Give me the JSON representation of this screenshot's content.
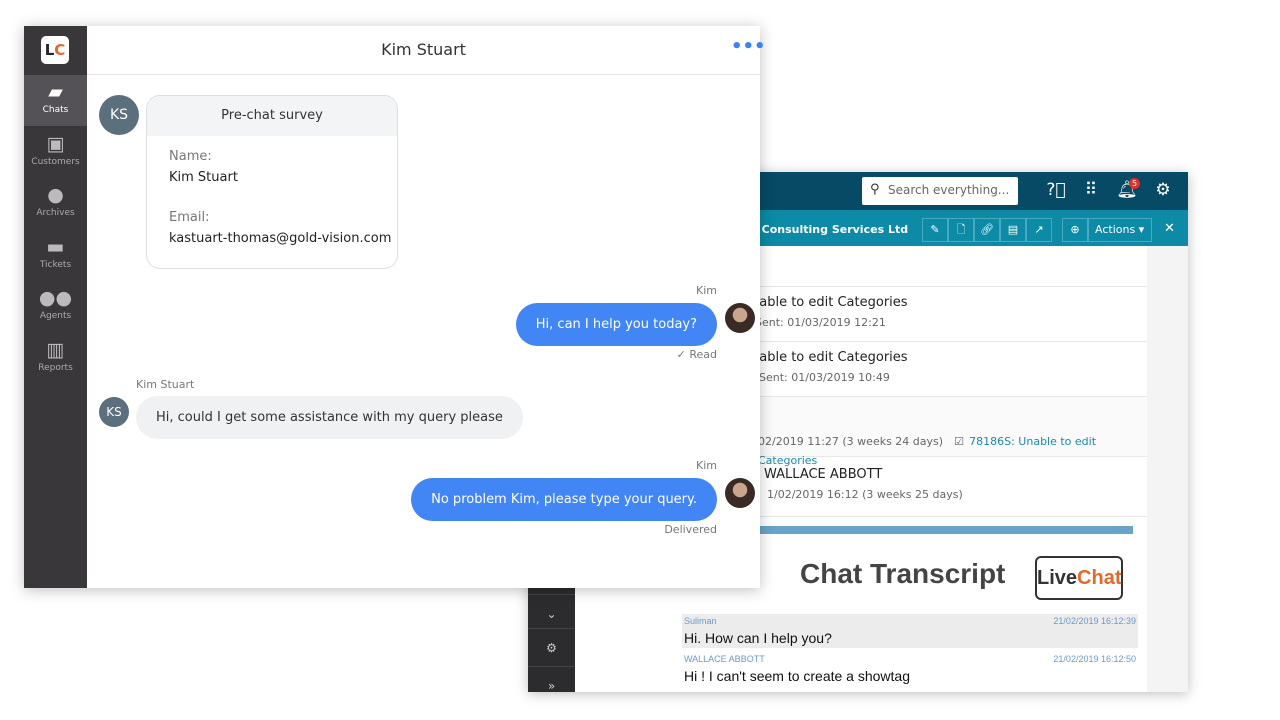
{
  "crm": {
    "search_placeholder": "Search everything...",
    "notification_count": "5",
    "company": "n Consulting Services Ltd",
    "actions_label": "Actions",
    "rows": [
      {
        "title": "nable to edit Categories",
        "sub": "Sent: 01/03/2019 12:21"
      },
      {
        "title": "nable to edit Categories",
        "sub": "Sent: 01/03/2019 10:49"
      },
      {
        "sub": "02/2019 11:27 (3 weeks 24 days)",
        "link": "78186S: Unable to edit Categories"
      },
      {
        "title": "WALLACE ABBOTT",
        "sub": "1/02/2019 16:12 (3 weeks 25 days)"
      }
    ],
    "transcript": {
      "title": "Chat Transcript",
      "logo": {
        "live": "Live",
        "chat": "Chat"
      },
      "messages": [
        {
          "author": "Suliman",
          "time": "21/02/2019 16:12:39",
          "text": "Hi. How can I help you?"
        },
        {
          "author": "WALLACE ABBOTT",
          "time": "21/02/2019 16:12:50",
          "text": "Hi ! I can't seem to create a showtag"
        }
      ]
    }
  },
  "livechat": {
    "logo": "LC",
    "nav": [
      {
        "label": "Chats",
        "icon": "chat-icon"
      },
      {
        "label": "Customers",
        "icon": "customer-icon"
      },
      {
        "label": "Archives",
        "icon": "clock-icon"
      },
      {
        "label": "Tickets",
        "icon": "ticket-icon"
      },
      {
        "label": "Agents",
        "icon": "agents-icon"
      },
      {
        "label": "Reports",
        "icon": "reports-icon"
      }
    ],
    "title": "Kim Stuart",
    "customer_initials": "KS",
    "survey": {
      "title": "Pre-chat survey",
      "name_label": "Name:",
      "name": "Kim Stuart",
      "email_label": "Email:",
      "email": "kastuart-thomas@gold-vision.com"
    },
    "messages": [
      {
        "author": "Kim",
        "text": "Hi, can I help you today?",
        "status": "Read"
      },
      {
        "author": "Kim Stuart",
        "text": "Hi, could I get some assistance with my query please"
      },
      {
        "author": "Kim",
        "text": "No problem Kim, please type your query.",
        "status": "Delivered"
      }
    ],
    "accent": "#4285f4"
  }
}
